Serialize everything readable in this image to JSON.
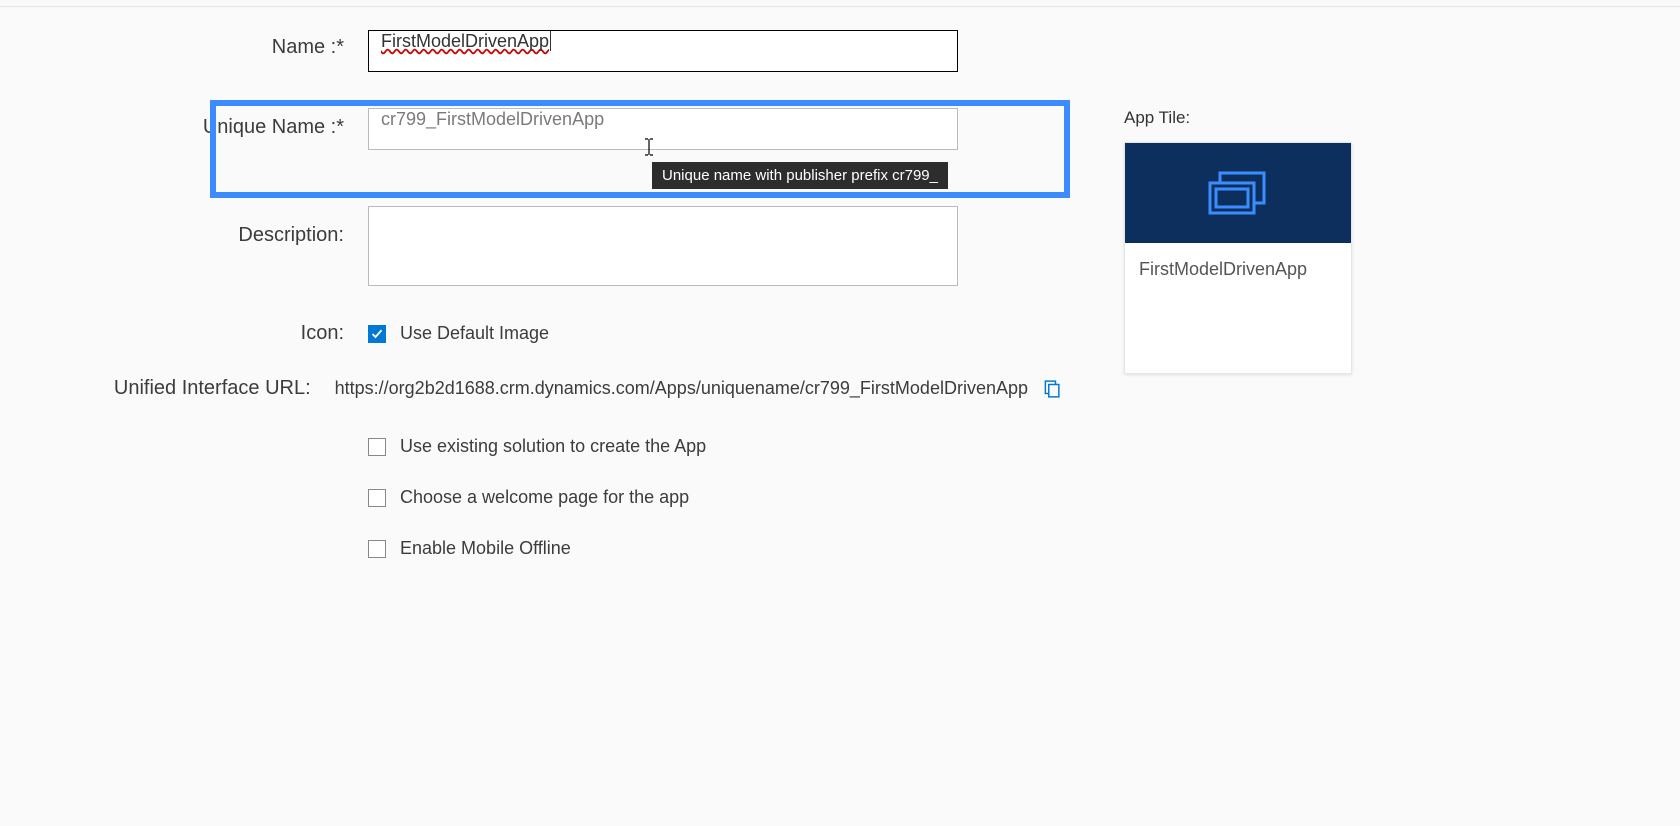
{
  "form": {
    "name": {
      "label": "Name :*",
      "value": "FirstModelDrivenApp"
    },
    "uniqueName": {
      "label": "Unique Name :*",
      "value": "cr799_FirstModelDrivenApp",
      "tooltip": "Unique name with publisher prefix cr799_"
    },
    "description": {
      "label": "Description:",
      "value": ""
    },
    "icon": {
      "label": "Icon:",
      "checkbox_label": "Use Default Image",
      "checked": true
    },
    "unifiedUrl": {
      "label": "Unified Interface URL:",
      "value": "https://org2b2d1688.crm.dynamics.com/Apps/uniquename/cr799_FirstModelDrivenApp"
    },
    "options": {
      "useExisting": {
        "label": "Use existing solution to create the App",
        "checked": false
      },
      "welcomePage": {
        "label": "Choose a welcome page for the app",
        "checked": false
      },
      "mobileOffline": {
        "label": "Enable Mobile Offline",
        "checked": false
      }
    }
  },
  "appTile": {
    "sectionLabel": "App Tile:",
    "title": "FirstModelDrivenApp"
  }
}
